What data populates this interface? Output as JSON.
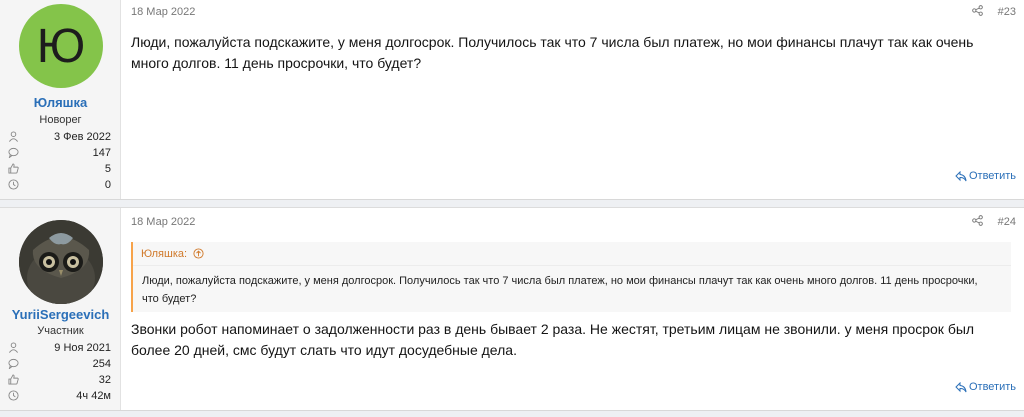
{
  "posts": [
    {
      "date": "18 Мар 2022",
      "number": "#23",
      "user": {
        "avatar_letter": "Ю",
        "avatar_color": "#84c44a",
        "name": "Юляшка",
        "title": "Новорег",
        "joined": "3 Фев 2022",
        "messages": "147",
        "reactions": "5",
        "points": "0"
      },
      "text": "Люди, пожалуйста подскажите, у меня долгосрок. Получилось так что 7 числа был платеж, но мои финансы плачут так как очень много долгов. 11 день просрочки, что будет?",
      "reply_label": "Ответить"
    },
    {
      "date": "18 Мар 2022",
      "number": "#24",
      "user": {
        "name": "YuriiSergeevich",
        "title": "Участник",
        "joined": "9 Ноя 2021",
        "messages": "254",
        "reactions": "32",
        "points": "4ч 42м"
      },
      "quote": {
        "author": "Юляшка:",
        "text": "Люди, пожалуйста подскажите, у меня долгосрок. Получилось так что 7 числа был платеж, но мои финансы плачут так как очень много долгов. 11 день просрочки, что будет?"
      },
      "text": "Звонки робот напоминает о задолженности раз в день бывает 2 раза. Не жестят, третьим лицам не звонили. у меня просрок был более 20 дней, смс будут слать что идут досудебные дела.",
      "reply_label": "Ответить"
    }
  ],
  "colors": {
    "link": "#2a6fb8",
    "quote_accent": "#f7a34a"
  }
}
